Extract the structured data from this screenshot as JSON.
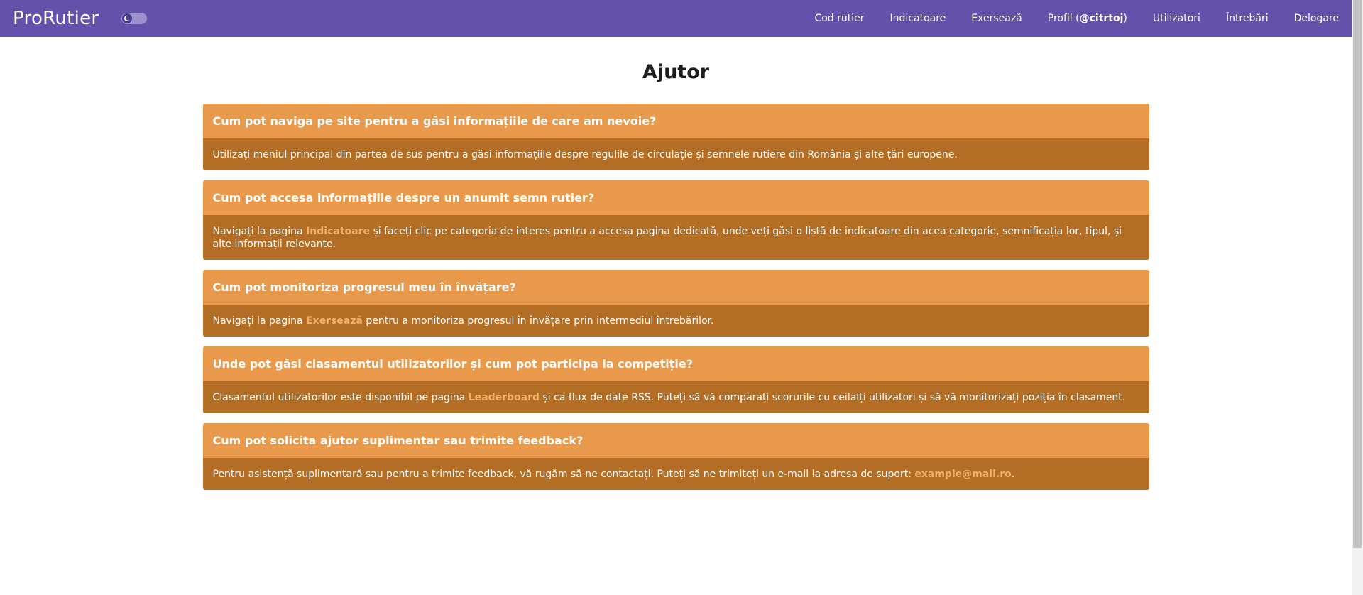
{
  "navbar": {
    "brand": "ProRutier",
    "links": [
      {
        "label": "Cod rutier"
      },
      {
        "label": "Indicatoare"
      },
      {
        "label": "Exersează"
      },
      {
        "label_prefix": "Profil (",
        "handle": "@citrtoj",
        "label_suffix": ")"
      },
      {
        "label": "Utilizatori"
      },
      {
        "label": "Întrebări"
      },
      {
        "label": "Delogare"
      }
    ],
    "toggle_icon": "moon-icon"
  },
  "main": {
    "title": "Ajutor",
    "faqs": [
      {
        "question": "Cum pot naviga pe site pentru a găsi informațiile de care am nevoie?",
        "answer_text": "Utilizați meniul principal din partea de sus pentru a găsi informațiile despre regulile de circulație și semnele rutiere din România și alte țări europene."
      },
      {
        "question": "Cum pot accesa informațiile despre un anumit semn rutier?",
        "answer_before": "Navigați la pagina ",
        "answer_link": "Indicatoare",
        "answer_after": " și faceți clic pe categoria de interes pentru a accesa pagina dedicată, unde veți găsi o listă de indicatoare din acea categorie, semnificația lor, tipul, și alte informații relevante."
      },
      {
        "question": "Cum pot monitoriza progresul meu în învățare?",
        "answer_before": "Navigați la pagina ",
        "answer_link": "Exersează",
        "answer_after": " pentru a monitoriza progresul în învățare prin intermediul întrebărilor."
      },
      {
        "question": "Unde pot găsi clasamentul utilizatorilor și cum pot participa la competiție?",
        "answer_before": "Clasamentul utilizatorilor este disponibil pe pagina ",
        "answer_link": "Leaderboard",
        "answer_after": " și ca flux de date RSS. Puteți să vă comparați scorurile cu ceilalți utilizatori și să vă monitorizați poziția în clasament."
      },
      {
        "question": "Cum pot solicita ajutor suplimentar sau trimite feedback?",
        "answer_before": "Pentru asistență suplimentară sau pentru a trimite feedback, vă rugăm să ne contactați. Puteți să ne trimiteți un e-mail la adresa de suport: ",
        "answer_link": "example@mail.ro",
        "answer_after": "."
      }
    ]
  },
  "colors": {
    "navbar": "#6351ab",
    "question_bg": "#e8994b",
    "answer_bg": "#b46d24",
    "link": "#f0b06a"
  }
}
